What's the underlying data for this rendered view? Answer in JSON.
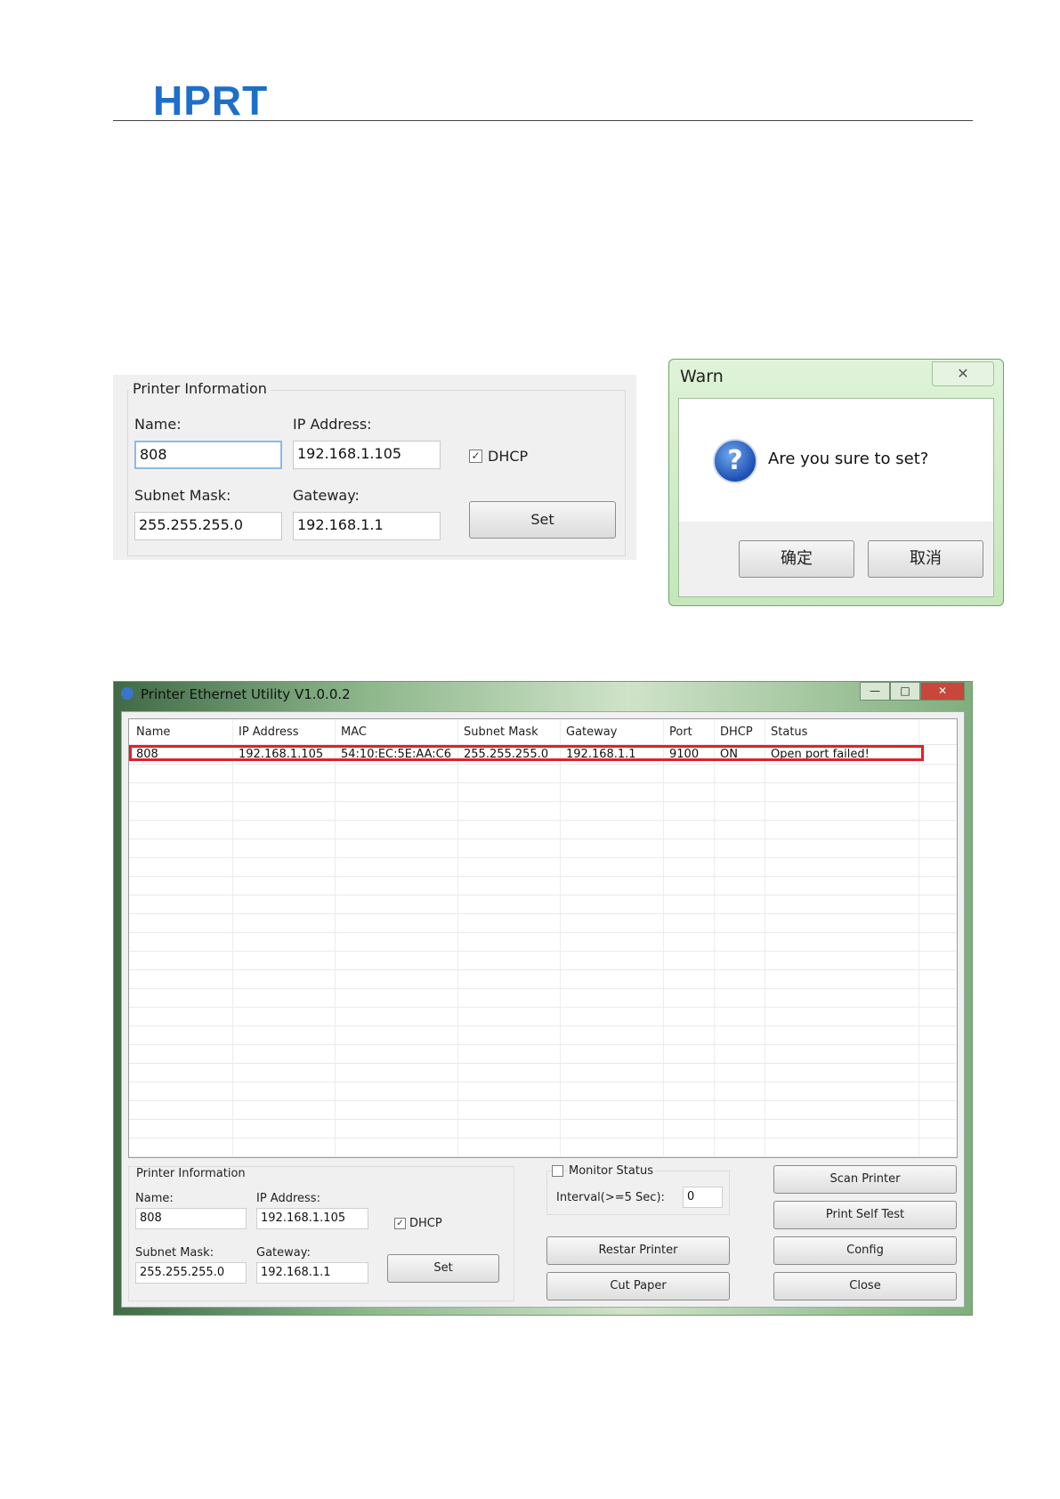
{
  "header": {
    "logo_text": "HPRT",
    "brand_color": "#1e6fc8"
  },
  "top_panel": {
    "legend": "Printer Information",
    "name_label": "Name:",
    "name_value": "808",
    "ip_label": "IP Address:",
    "ip_value": "192.168.1.105",
    "dhcp_label": "DHCP",
    "dhcp_checked": true,
    "subnet_label": "Subnet Mask:",
    "subnet_value": "255.255.255.0",
    "gateway_label": "Gateway:",
    "gateway_value": "192.168.1.1",
    "set_label": "Set"
  },
  "warn_dialog": {
    "title": "Warn",
    "close_glyph": "✕",
    "question_glyph": "?",
    "message": "Are you sure to set?",
    "ok_label": "确定",
    "cancel_label": "取消"
  },
  "app": {
    "title": "Printer Ethernet Utility  V1.0.0.2",
    "controls": {
      "minimize": "—",
      "maximize": "□",
      "close": "✕"
    },
    "columns": [
      "Name",
      "IP Address",
      "MAC",
      "Subnet Mask",
      "Gateway",
      "Port",
      "DHCP",
      "Status"
    ],
    "rows": [
      [
        "808",
        "192.168.1.105",
        "54:10:EC:5E:AA:C6",
        "255.255.255.0",
        "192.168.1.1",
        "9100",
        "ON",
        "Open port failed!"
      ]
    ],
    "printer_info": {
      "legend": "Printer Information",
      "name_label": "Name:",
      "name_value": "808",
      "ip_label": "IP Address:",
      "ip_value": "192.168.1.105",
      "dhcp_label": "DHCP",
      "dhcp_checked": true,
      "subnet_label": "Subnet Mask:",
      "subnet_value": "255.255.255.0",
      "gateway_label": "Gateway:",
      "gateway_value": "192.168.1.1",
      "set_label": "Set"
    },
    "monitor": {
      "label": "Monitor Status",
      "checked": false,
      "interval_label": "Interval(>=5 Sec):",
      "interval_value": "0"
    },
    "buttons": {
      "restart": "Restar Printer",
      "cut_paper": "Cut Paper",
      "scan": "Scan Printer",
      "self_test": "Print Self Test",
      "config": "Config",
      "close": "Close"
    },
    "highlight_color": "#e0202a"
  }
}
